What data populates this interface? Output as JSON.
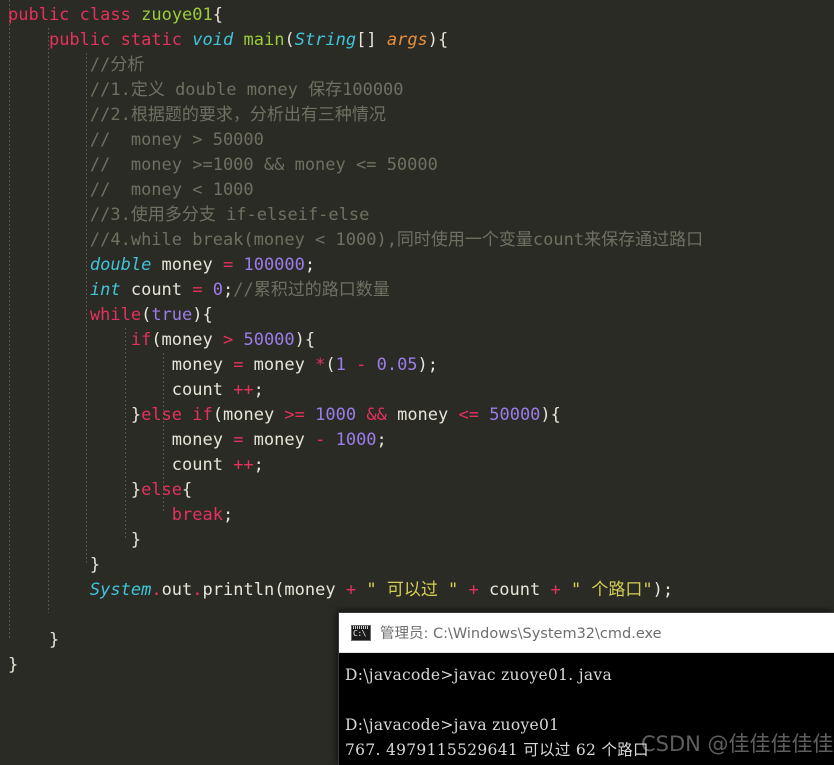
{
  "editor": {
    "background_color": "#2b2b26",
    "syntax_colors": {
      "keyword": "#e5315c",
      "type": "#3fc4d8",
      "class_name": "#9ccc3a",
      "number": "#9b7ce8",
      "string": "#d4cf52",
      "comment": "#6f7061",
      "plain": "#e7e4d8",
      "parameter": "#e8903a"
    },
    "lines": [
      {
        "indent": 0,
        "tokens": [
          {
            "t": "public",
            "c": "kw"
          },
          {
            "t": " ",
            "c": "pl"
          },
          {
            "t": "class",
            "c": "kw"
          },
          {
            "t": " ",
            "c": "pl"
          },
          {
            "t": "zuoye01",
            "c": "cls"
          },
          {
            "t": "{",
            "c": "pl"
          }
        ]
      },
      {
        "indent": 1,
        "tokens": [
          {
            "t": "public",
            "c": "kw"
          },
          {
            "t": " ",
            "c": "pl"
          },
          {
            "t": "static",
            "c": "kw"
          },
          {
            "t": " ",
            "c": "pl"
          },
          {
            "t": "void",
            "c": "type"
          },
          {
            "t": " ",
            "c": "pl"
          },
          {
            "t": "main",
            "c": "fn"
          },
          {
            "t": "(",
            "c": "pl"
          },
          {
            "t": "String",
            "c": "type"
          },
          {
            "t": "[] ",
            "c": "pl"
          },
          {
            "t": "args",
            "c": "var"
          },
          {
            "t": "){",
            "c": "pl"
          }
        ]
      },
      {
        "indent": 2,
        "tokens": [
          {
            "t": "//分析",
            "c": "cmt"
          }
        ]
      },
      {
        "indent": 2,
        "tokens": [
          {
            "t": "//1.定义 double money 保存100000",
            "c": "cmt"
          }
        ]
      },
      {
        "indent": 2,
        "tokens": [
          {
            "t": "//2.根据题的要求，分析出有三种情况",
            "c": "cmt"
          }
        ]
      },
      {
        "indent": 2,
        "tokens": [
          {
            "t": "//  money > 50000",
            "c": "cmt"
          }
        ]
      },
      {
        "indent": 2,
        "tokens": [
          {
            "t": "//  money >=1000 && money <= 50000",
            "c": "cmt"
          }
        ]
      },
      {
        "indent": 2,
        "tokens": [
          {
            "t": "//  money < 1000",
            "c": "cmt"
          }
        ]
      },
      {
        "indent": 2,
        "tokens": [
          {
            "t": "//3.使用多分支 if-elseif-else",
            "c": "cmt"
          }
        ]
      },
      {
        "indent": 2,
        "tokens": [
          {
            "t": "//4.while break(money < 1000),同时使用一个变量count来保存通过路口",
            "c": "cmt"
          }
        ]
      },
      {
        "indent": 2,
        "tokens": [
          {
            "t": "double",
            "c": "type"
          },
          {
            "t": " money ",
            "c": "pl"
          },
          {
            "t": "=",
            "c": "op"
          },
          {
            "t": " ",
            "c": "pl"
          },
          {
            "t": "100000",
            "c": "num"
          },
          {
            "t": ";",
            "c": "pl"
          }
        ]
      },
      {
        "indent": 2,
        "tokens": [
          {
            "t": "int",
            "c": "type"
          },
          {
            "t": " count ",
            "c": "pl"
          },
          {
            "t": "=",
            "c": "op"
          },
          {
            "t": " ",
            "c": "pl"
          },
          {
            "t": "0",
            "c": "num"
          },
          {
            "t": ";",
            "c": "pl"
          },
          {
            "t": "//累积过的路口数量",
            "c": "cmt"
          }
        ]
      },
      {
        "indent": 2,
        "tokens": [
          {
            "t": "while",
            "c": "kw"
          },
          {
            "t": "(",
            "c": "pl"
          },
          {
            "t": "true",
            "c": "num"
          },
          {
            "t": "){",
            "c": "pl"
          }
        ]
      },
      {
        "indent": 3,
        "tokens": [
          {
            "t": "if",
            "c": "kw"
          },
          {
            "t": "(money ",
            "c": "pl"
          },
          {
            "t": ">",
            "c": "op"
          },
          {
            "t": " ",
            "c": "pl"
          },
          {
            "t": "50000",
            "c": "num"
          },
          {
            "t": "){",
            "c": "pl"
          }
        ]
      },
      {
        "indent": 4,
        "tokens": [
          {
            "t": "money ",
            "c": "pl"
          },
          {
            "t": "=",
            "c": "op"
          },
          {
            "t": " money ",
            "c": "pl"
          },
          {
            "t": "*",
            "c": "op"
          },
          {
            "t": "(",
            "c": "pl"
          },
          {
            "t": "1",
            "c": "num"
          },
          {
            "t": " ",
            "c": "pl"
          },
          {
            "t": "-",
            "c": "op"
          },
          {
            "t": " ",
            "c": "pl"
          },
          {
            "t": "0.05",
            "c": "num"
          },
          {
            "t": ");",
            "c": "pl"
          }
        ]
      },
      {
        "indent": 4,
        "tokens": [
          {
            "t": "count ",
            "c": "pl"
          },
          {
            "t": "++",
            "c": "op"
          },
          {
            "t": ";",
            "c": "pl"
          }
        ]
      },
      {
        "indent": 3,
        "tokens": [
          {
            "t": "}",
            "c": "pl"
          },
          {
            "t": "else",
            "c": "kw"
          },
          {
            "t": " ",
            "c": "pl"
          },
          {
            "t": "if",
            "c": "kw"
          },
          {
            "t": "(money ",
            "c": "pl"
          },
          {
            "t": ">=",
            "c": "op"
          },
          {
            "t": " ",
            "c": "pl"
          },
          {
            "t": "1000",
            "c": "num"
          },
          {
            "t": " ",
            "c": "pl"
          },
          {
            "t": "&&",
            "c": "op"
          },
          {
            "t": " money ",
            "c": "pl"
          },
          {
            "t": "<=",
            "c": "op"
          },
          {
            "t": " ",
            "c": "pl"
          },
          {
            "t": "50000",
            "c": "num"
          },
          {
            "t": "){",
            "c": "pl"
          }
        ]
      },
      {
        "indent": 4,
        "tokens": [
          {
            "t": "money ",
            "c": "pl"
          },
          {
            "t": "=",
            "c": "op"
          },
          {
            "t": " money ",
            "c": "pl"
          },
          {
            "t": "-",
            "c": "op"
          },
          {
            "t": " ",
            "c": "pl"
          },
          {
            "t": "1000",
            "c": "num"
          },
          {
            "t": ";",
            "c": "pl"
          }
        ]
      },
      {
        "indent": 4,
        "tokens": [
          {
            "t": "count ",
            "c": "pl"
          },
          {
            "t": "++",
            "c": "op"
          },
          {
            "t": ";",
            "c": "pl"
          }
        ]
      },
      {
        "indent": 3,
        "tokens": [
          {
            "t": "}",
            "c": "pl"
          },
          {
            "t": "else",
            "c": "kw"
          },
          {
            "t": "{",
            "c": "pl"
          }
        ]
      },
      {
        "indent": 4,
        "tokens": [
          {
            "t": "break",
            "c": "kw"
          },
          {
            "t": ";",
            "c": "pl"
          }
        ]
      },
      {
        "indent": 3,
        "tokens": [
          {
            "t": "}",
            "c": "pl"
          }
        ]
      },
      {
        "indent": 2,
        "tokens": [
          {
            "t": "}",
            "c": "pl"
          }
        ]
      },
      {
        "indent": 2,
        "tokens": [
          {
            "t": "System",
            "c": "sysname"
          },
          {
            "t": ".",
            "c": "op"
          },
          {
            "t": "out",
            "c": "pl"
          },
          {
            "t": ".",
            "c": "op"
          },
          {
            "t": "println",
            "c": "pl"
          },
          {
            "t": "(money ",
            "c": "pl"
          },
          {
            "t": "+",
            "c": "op"
          },
          {
            "t": " ",
            "c": "pl"
          },
          {
            "t": "\" 可以过 \"",
            "c": "str"
          },
          {
            "t": " ",
            "c": "pl"
          },
          {
            "t": "+",
            "c": "op"
          },
          {
            "t": " count ",
            "c": "pl"
          },
          {
            "t": "+",
            "c": "op"
          },
          {
            "t": " ",
            "c": "pl"
          },
          {
            "t": "\" 个路口\"",
            "c": "str"
          },
          {
            "t": ");",
            "c": "pl"
          }
        ]
      },
      {
        "indent": 0,
        "tokens": []
      },
      {
        "indent": 1,
        "tokens": [
          {
            "t": "}",
            "c": "pl"
          }
        ]
      },
      {
        "indent": 0,
        "tokens": [
          {
            "t": "}",
            "c": "pl"
          }
        ]
      }
    ]
  },
  "cmd_window": {
    "title": "管理员: C:\\Windows\\System32\\cmd.exe",
    "icon_label": "C:\\",
    "console_lines": [
      "D:\\javacode>javac zuoye01. java",
      "",
      "D:\\javacode>java zuoye01",
      "767. 4979115529641 可以过 62 个路口"
    ]
  },
  "watermark": {
    "text": "CSDN @佳佳佳佳佳"
  }
}
